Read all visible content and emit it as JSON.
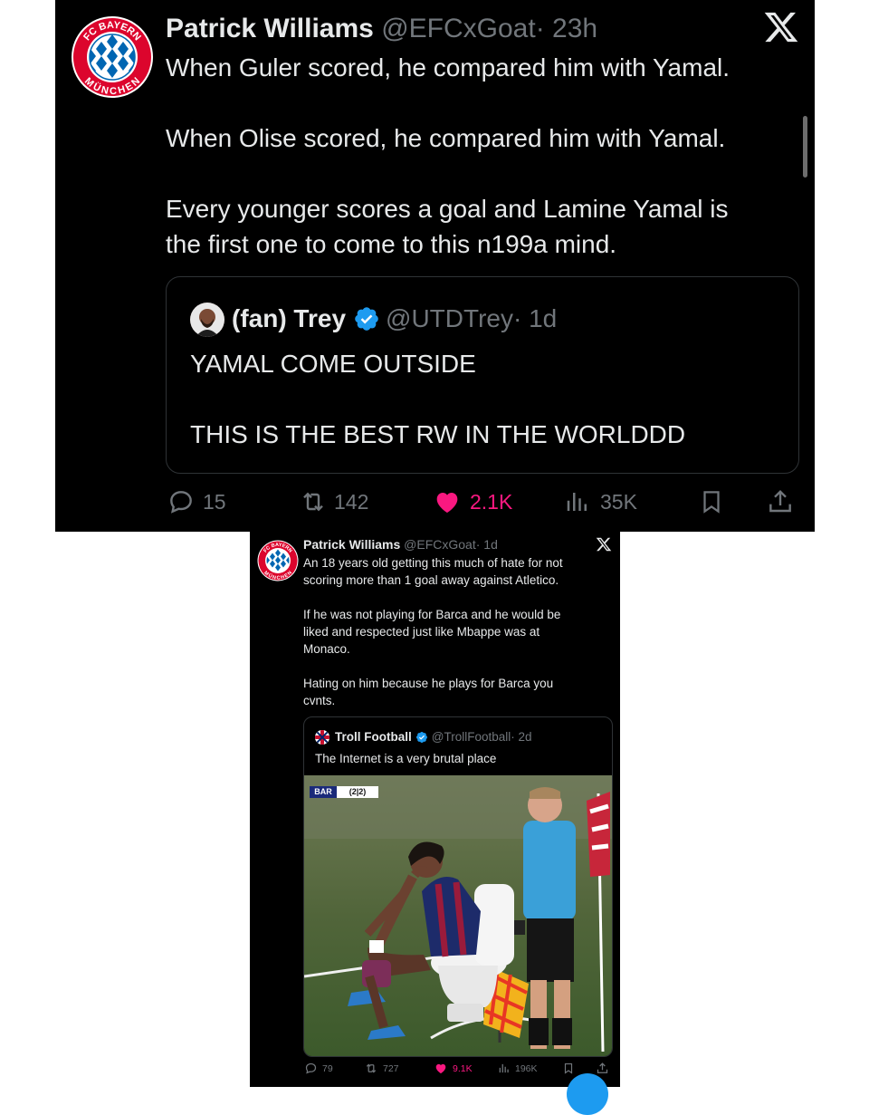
{
  "tweet1": {
    "author_name": "Patrick Williams",
    "handle": "@EFCxGoat",
    "time": "· 23h",
    "text": "When Guler scored, he compared him with Yamal.\n\nWhen Olise scored, he compared him with Yamal.\n\nEvery younger scores a goal and Lamine Yamal is\nthe first one to come to this n199a mind.",
    "logo_top": "FC BAYERN",
    "logo_bottom": "MÜNCHEN",
    "quote": {
      "author_name": "(fan) Trey",
      "handle": "@UTDTrey",
      "time": "· 1d",
      "text": "YAMAL COME OUTSIDE\n\nTHIS IS THE BEST RW IN THE WORLDDD"
    },
    "actions": {
      "replies": "15",
      "reposts": "142",
      "likes": "2.1K",
      "views": "35K"
    }
  },
  "tweet2": {
    "author_name": "Patrick Williams",
    "handle": "@EFCxGoat",
    "time": "· 1d",
    "text": "An 18 years old getting this much of hate for not\nscoring more than 1 goal away against Atletico.\n\nIf he was not playing for Barca and he would be\nliked and respected just like Mbappe was at\nMonaco.\n\nHating on him because he plays for Barca you\ncvnts.",
    "quote": {
      "author_name": "Troll Football",
      "handle": "@TrollFootball",
      "time": "· 2d",
      "text": "The Internet is a very brutal place",
      "score_team": "BAR",
      "score_value": "(2|2)"
    },
    "actions": {
      "replies": "79",
      "reposts": "727",
      "likes": "9.1K",
      "views": "196K"
    }
  },
  "colors": {
    "background": "#000000",
    "text": "#e7e9ea",
    "muted": "#71767b",
    "like": "#f91880",
    "verified": "#1d9bf0",
    "bayern_red": "#dc052d",
    "bayern_blue": "#0066b2"
  }
}
